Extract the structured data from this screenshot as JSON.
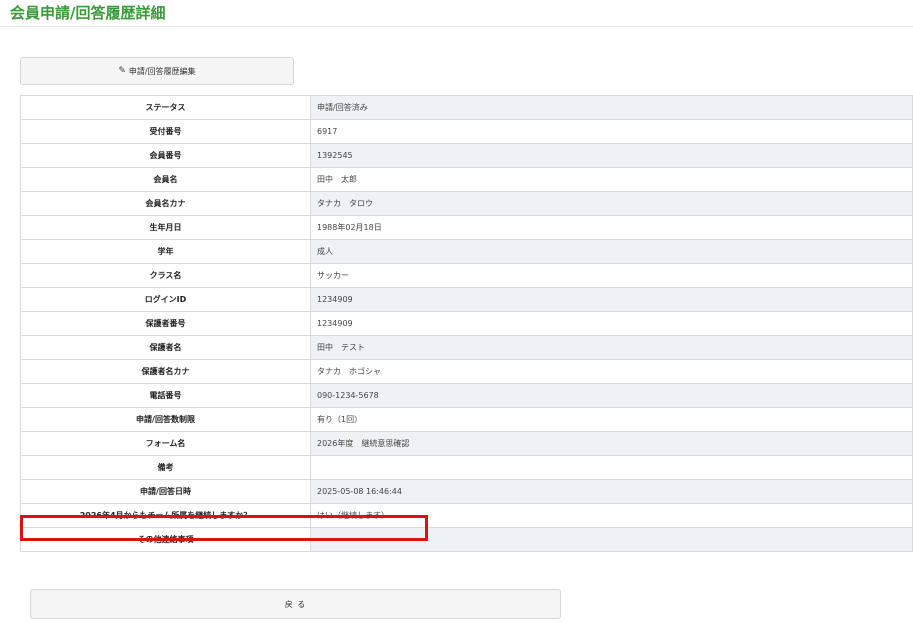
{
  "header": {
    "title": "会員申請/回答履歴詳細"
  },
  "toolbar": {
    "edit_label": "申請/回答履歴編集",
    "back_label": "戻 る"
  },
  "icons": {
    "edit": "pencil-icon"
  },
  "highlight_color": "#e01010",
  "details": [
    {
      "label": "ステータス",
      "value": "申請/回答済み"
    },
    {
      "label": "受付番号",
      "value": "6917"
    },
    {
      "label": "会員番号",
      "value": "1392545"
    },
    {
      "label": "会員名",
      "value": "田中　太郎"
    },
    {
      "label": "会員名カナ",
      "value": "タナカ　タロウ"
    },
    {
      "label": "生年月日",
      "value": "1988年02月18日"
    },
    {
      "label": "学年",
      "value": "成人"
    },
    {
      "label": "クラス名",
      "value": "サッカー"
    },
    {
      "label": "ログインID",
      "value": "1234909"
    },
    {
      "label": "保護者番号",
      "value": "1234909"
    },
    {
      "label": "保護者名",
      "value": "田中　テスト"
    },
    {
      "label": "保護者名カナ",
      "value": "タナカ　ホゴシャ"
    },
    {
      "label": "電話番号",
      "value": "090-1234-5678"
    },
    {
      "label": "申請/回答数制限",
      "value": "有り（1回）"
    },
    {
      "label": "フォーム名",
      "value": "2026年度　継続意思確認"
    },
    {
      "label": "備考",
      "value": ""
    },
    {
      "label": "申請/回答日時",
      "value": "2025-05-08 16:46:44"
    },
    {
      "label": "2026年4月からもチーム所属を継続しますか？",
      "value": "はい（継続します）"
    },
    {
      "label": "その他連絡事項",
      "value": ""
    }
  ]
}
